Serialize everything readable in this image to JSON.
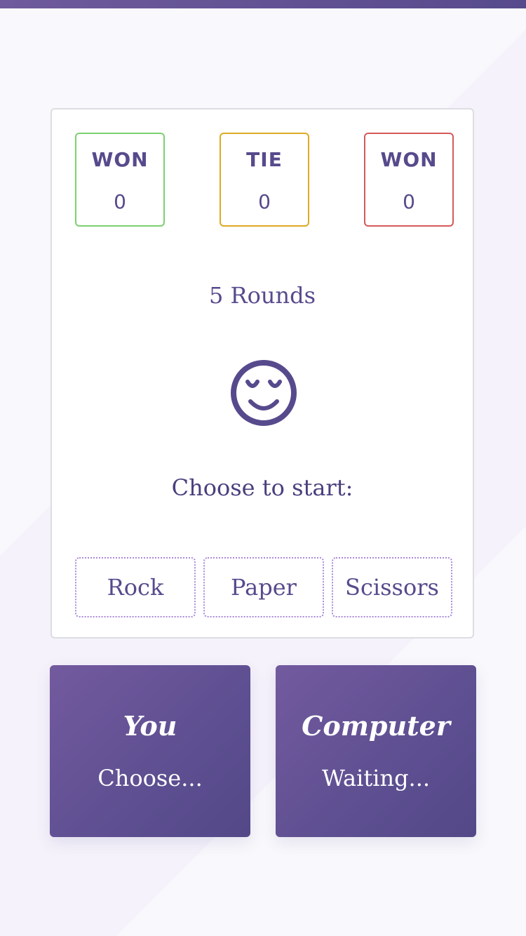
{
  "scoreboard": {
    "player_wins": {
      "label": "WON",
      "value": "0",
      "color": "#7ad26e"
    },
    "ties": {
      "label": "TIE",
      "value": "0",
      "color": "#deaa24"
    },
    "computer_wins": {
      "label": "WON",
      "value": "0",
      "color": "#d45a5a"
    }
  },
  "rounds_label": "5 Rounds",
  "status_icon": "relieved-face-icon",
  "prompt": "Choose to start:",
  "choices": [
    {
      "label": "Rock"
    },
    {
      "label": "Paper"
    },
    {
      "label": "Scissors"
    }
  ],
  "players": {
    "you": {
      "name": "You",
      "status": "Choose..."
    },
    "computer": {
      "name": "Computer",
      "status": "Waiting..."
    }
  },
  "colors": {
    "accent": "#574a8c",
    "panel_gradient_start": "#735a9e",
    "panel_gradient_end": "#544888",
    "choice_border": "#a98ad8"
  }
}
